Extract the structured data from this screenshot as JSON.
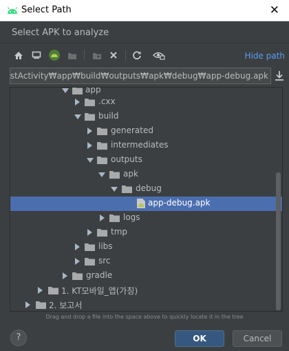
{
  "window": {
    "title": "Select Path",
    "close_glyph": "✕"
  },
  "dialog": {
    "subtitle": "Select APK to analyze"
  },
  "toolbar": {
    "icons": [
      "home-icon",
      "desktop-icon",
      "android-project-icon",
      "module-icon",
      "new-folder-icon",
      "delete-icon",
      "refresh-icon",
      "show-hidden-icon"
    ],
    "hide_path_label": "Hide path"
  },
  "path": {
    "value": "e₩JarTestActivity₩app₩build₩outputs₩apk₩debug₩app-debug.apk"
  },
  "tree": {
    "items": [
      {
        "label": "app",
        "expanded": true
      },
      {
        "label": ".cxx",
        "expanded": false
      },
      {
        "label": "build",
        "expanded": true
      },
      {
        "label": "generated",
        "expanded": false
      },
      {
        "label": "intermediates",
        "expanded": false
      },
      {
        "label": "outputs",
        "expanded": true
      },
      {
        "label": "apk",
        "expanded": true
      },
      {
        "label": "debug",
        "expanded": true
      },
      {
        "label": "app-debug.apk",
        "selected": true
      },
      {
        "label": "logs",
        "expanded": false
      },
      {
        "label": "tmp",
        "expanded": false
      },
      {
        "label": "libs",
        "expanded": false
      },
      {
        "label": "src",
        "expanded": false
      },
      {
        "label": "gradle",
        "expanded": false
      },
      {
        "label": "1. KT모바일_앱(가칭)",
        "expanded": false
      },
      {
        "label": "2. 보고서",
        "expanded": false
      }
    ]
  },
  "hint": "Drag and drop a file into the space above to quickly locate it in the tree",
  "buttons": {
    "help": "?",
    "ok": "OK",
    "cancel": "Cancel"
  },
  "colors": {
    "background": "#3c3f41",
    "selection": "#4b6eaf",
    "link": "#589df6",
    "folder": "#a9aaab",
    "android": "#a4c639"
  }
}
